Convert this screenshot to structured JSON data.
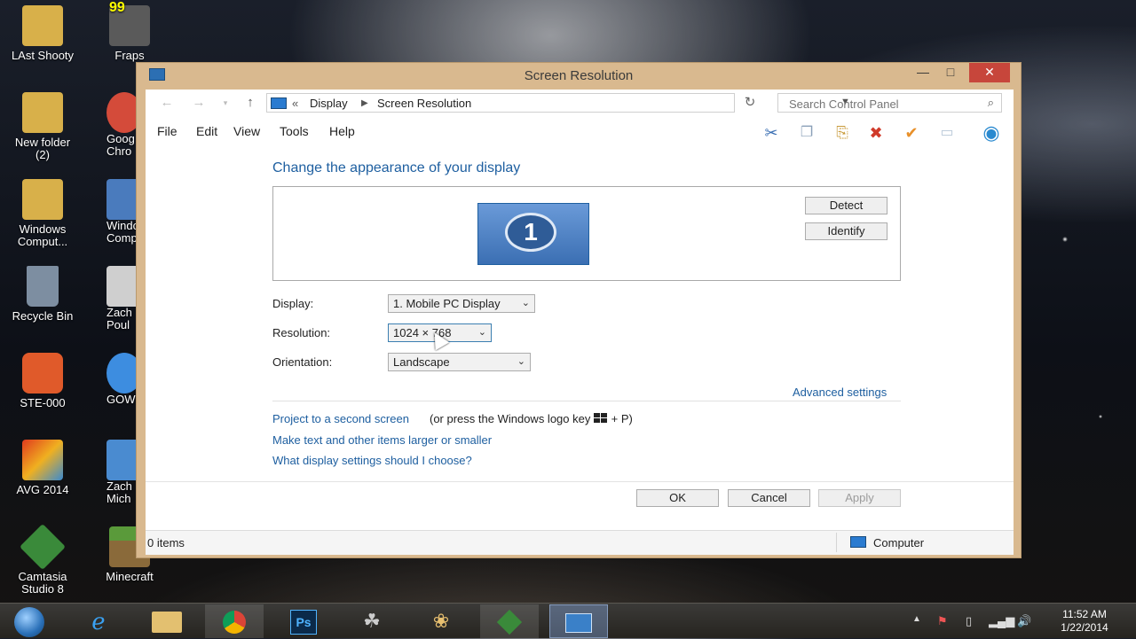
{
  "desktop": {
    "icons": [
      {
        "label": "LAst Shooty",
        "color": "#d8b04a"
      },
      {
        "label": "Fraps",
        "badge": "99",
        "color": "#5a5a5a"
      },
      {
        "label": "New folder (2)",
        "color": "#d8b04a"
      },
      {
        "label": "Goog Chro",
        "color": "#d44b3a"
      },
      {
        "label": "Windows Comput...",
        "color": "#d8b04a"
      },
      {
        "label": "Windo Comp",
        "color": "#4a7bbd"
      },
      {
        "label": "Recycle Bin",
        "color": "#7d8ea1"
      },
      {
        "label": "Zach Poul",
        "color": "#cfcfcf"
      },
      {
        "label": "STE-000",
        "color": "#e05a2a"
      },
      {
        "label": "GOWC",
        "color": "#3d8de0"
      },
      {
        "label": "AVG 2014",
        "color": "#e07a1e"
      },
      {
        "label": "Zach Mich",
        "color": "#4a8bd0"
      },
      {
        "label": "Camtasia Studio 8",
        "color": "#3a8a3a"
      },
      {
        "label": "Minecraft",
        "color": "#5a9a3a"
      }
    ]
  },
  "window": {
    "title": "Screen Resolution",
    "address": {
      "overflow": "«",
      "crumbs": [
        "Display",
        "Screen Resolution"
      ],
      "search_placeholder": "Search Control Panel"
    },
    "menu": [
      "File",
      "Edit",
      "View",
      "Tools",
      "Help"
    ],
    "heading": "Change the appearance of your display",
    "monitor_number": "1",
    "detect_label": "Detect",
    "identify_label": "Identify",
    "fields": {
      "display_label": "Display:",
      "display_value": "1. Mobile PC Display",
      "resolution_label": "Resolution:",
      "resolution_value": "1024 × 768",
      "orientation_label": "Orientation:",
      "orientation_value": "Landscape"
    },
    "advanced_link": "Advanced settings",
    "project_link": "Project to a second screen",
    "project_suffix_a": "(or press the Windows logo key",
    "project_suffix_b": "+ P)",
    "text_size_link": "Make text and other items larger or smaller",
    "help_link": "What display settings should I choose?",
    "ok_label": "OK",
    "cancel_label": "Cancel",
    "apply_label": "Apply",
    "status_items": "0 items",
    "status_location": "Computer"
  },
  "taskbar": {
    "clock_time": "11:52 AM",
    "clock_date": "1/22/2014",
    "photoshop_label": "Ps"
  }
}
